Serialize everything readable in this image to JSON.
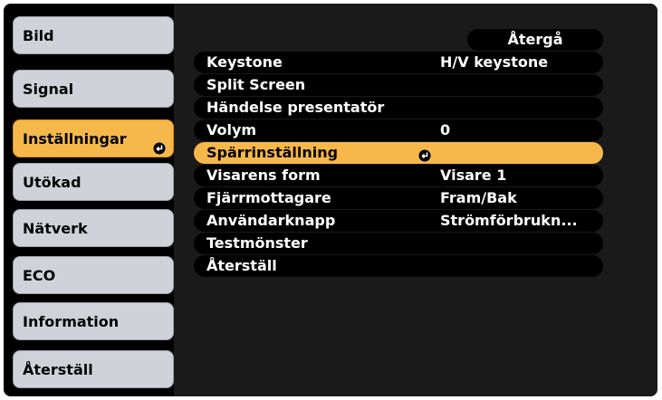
{
  "sidebar": {
    "items": [
      {
        "label": "Bild"
      },
      {
        "label": "Signal"
      },
      {
        "label": "Inställningar"
      },
      {
        "label": "Utökad"
      },
      {
        "label": "Nätverk"
      },
      {
        "label": "ECO"
      },
      {
        "label": "Information"
      },
      {
        "label": "Återställ"
      }
    ],
    "active_index": 2
  },
  "menu": {
    "back_label": "Återgå",
    "items": [
      {
        "label": "Keystone",
        "value": "H/V keystone"
      },
      {
        "label": "Split Screen",
        "value": ""
      },
      {
        "label": "Händelse presentatör",
        "value": ""
      },
      {
        "label": "Volym",
        "value": "0"
      },
      {
        "label": "Spärrinställning",
        "value": ""
      },
      {
        "label": "Visarens form",
        "value": "Visare 1"
      },
      {
        "label": "Fjärrmottagare",
        "value": "Fram/Bak"
      },
      {
        "label": "Användarknapp",
        "value": "Strömförbrukn..."
      },
      {
        "label": "Testmönster",
        "value": ""
      },
      {
        "label": "Återställ",
        "value": ""
      }
    ],
    "selected_index": 4
  },
  "colors": {
    "highlight": "#f6b84b",
    "button": "#cfd3d9",
    "background": "#000000"
  },
  "icons": {
    "enter": "enter-icon"
  }
}
